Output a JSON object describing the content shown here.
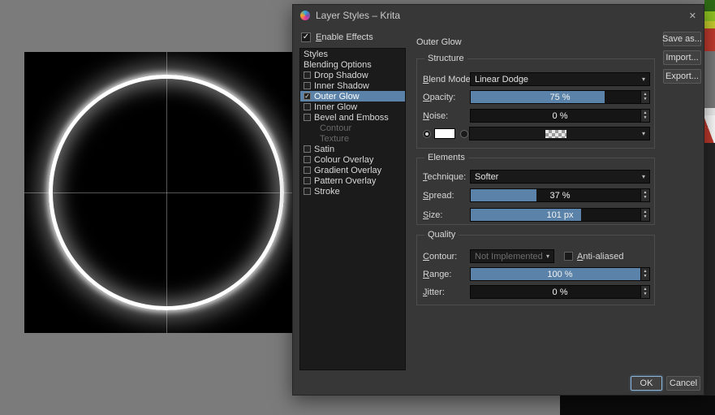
{
  "window": {
    "title": "Layer Styles – Krita"
  },
  "glyphs": {
    "check": "✓",
    "chevron_down": "▾",
    "spin_up": "▲",
    "spin_down": "▼",
    "close": "✕"
  },
  "colors": {
    "accent": "#5b82a8",
    "selection": "#5b82a8",
    "glow": "#ffffff",
    "fill_color": "#ffffff"
  },
  "enable_effects": {
    "label": "Enable Effects",
    "checked": true
  },
  "styles_list": {
    "items": [
      {
        "label": "Styles",
        "type": "plain"
      },
      {
        "label": "Blending Options",
        "type": "plain"
      },
      {
        "label": "Drop Shadow",
        "type": "checkbox",
        "checked": false
      },
      {
        "label": "Inner Shadow",
        "type": "checkbox",
        "checked": false
      },
      {
        "label": "Outer Glow",
        "type": "checkbox",
        "checked": true,
        "selected": true
      },
      {
        "label": "Inner Glow",
        "type": "checkbox",
        "checked": false
      },
      {
        "label": "Bevel and Emboss",
        "type": "checkbox",
        "checked": false
      },
      {
        "label": "Contour",
        "type": "disabled"
      },
      {
        "label": "Texture",
        "type": "disabled"
      },
      {
        "label": "Satin",
        "type": "checkbox",
        "checked": false
      },
      {
        "label": "Colour Overlay",
        "type": "checkbox",
        "checked": false
      },
      {
        "label": "Gradient Overlay",
        "type": "checkbox",
        "checked": false
      },
      {
        "label": "Pattern Overlay",
        "type": "checkbox",
        "checked": false
      },
      {
        "label": "Stroke",
        "type": "checkbox",
        "checked": false
      }
    ]
  },
  "panel": {
    "title": "Outer Glow",
    "structure": {
      "title": "Structure",
      "blend_mode_label": "Blend Mode:",
      "blend_mode_value": "Linear Dodge",
      "opacity_label": "Opacity:",
      "opacity_value": "75 %",
      "opacity_percent": 75,
      "noise_label": "Noise:",
      "noise_value": "0 %",
      "noise_percent": 0,
      "fill_color": "#ffffff"
    },
    "elements": {
      "title": "Elements",
      "technique_label": "Technique:",
      "technique_value": "Softer",
      "spread_label": "Spread:",
      "spread_value": "37 %",
      "spread_percent": 37,
      "size_label": "Size:",
      "size_value": "101 px",
      "size_percent": 62
    },
    "quality": {
      "title": "Quality",
      "contour_label": "Contour:",
      "contour_value": "Not Implemented Yet",
      "anti_aliased_label": "Anti-aliased",
      "anti_aliased_checked": false,
      "range_label": "Range:",
      "range_value": "100 %",
      "range_percent": 100,
      "jitter_label": "Jitter:",
      "jitter_value": "0 %",
      "jitter_percent": 0
    }
  },
  "side_buttons": {
    "save_as": "Save as...",
    "import": "Import...",
    "export": "Export..."
  },
  "footer": {
    "ok": "OK",
    "cancel": "Cancel"
  }
}
